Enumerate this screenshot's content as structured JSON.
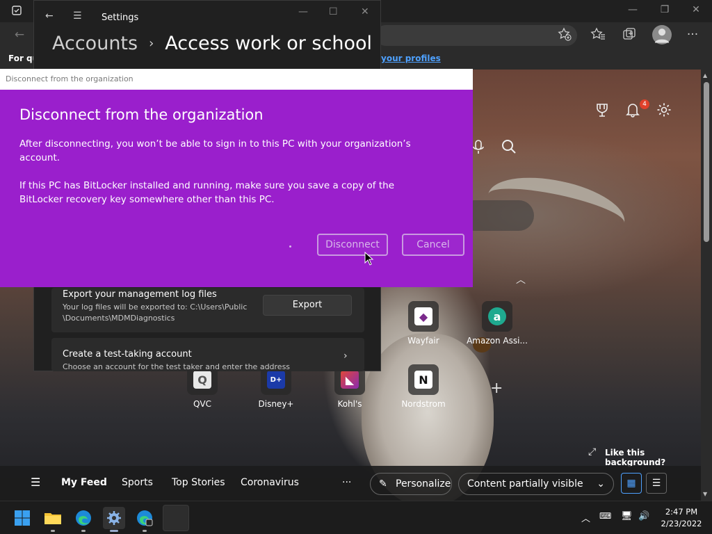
{
  "browser": {
    "favbar_label": "For qu",
    "favbar_link": "your profiles",
    "notifications_count": "4",
    "like_background": "Like this background?"
  },
  "tiles": [
    {
      "label": "Wayfair",
      "glyph": "◆",
      "color": "#7b2a8c"
    },
    {
      "label": "Amazon Assi...",
      "glyph": "a",
      "color": "#1fa98f"
    },
    {
      "label": "QVC",
      "glyph": "Q",
      "color": "#cfcfcf"
    },
    {
      "label": "Disney+",
      "glyph": "D+",
      "color": "#1b3aa8"
    },
    {
      "label": "Kohl's",
      "glyph": "◣",
      "color": "#b01c2c"
    },
    {
      "label": "Nordstrom",
      "glyph": "N",
      "color": "#ffffff"
    }
  ],
  "feed": {
    "items": [
      "My Feed",
      "Sports",
      "Top Stories",
      "Coronavirus"
    ],
    "more": "···",
    "personalize": "Personalize",
    "content_visibility": "Content partially visible"
  },
  "settings": {
    "title": "Settings",
    "breadcrumb_parent": "Accounts",
    "breadcrumb_current": "Access work or school",
    "export_card": {
      "title": "Export your management log files",
      "subtitle_line1": "Your log files will be exported to: C:\\Users\\Public",
      "subtitle_line2": "\\Documents\\MDMDiagnostics",
      "button": "Export"
    },
    "test_card": {
      "title": "Create a test-taking account",
      "subtitle": "Choose an account for the test taker and enter the address"
    }
  },
  "dialog": {
    "window_title": "Disconnect from the organization",
    "heading": "Disconnect from the organization",
    "paragraph1": "After disconnecting, you won’t be able to sign in to this PC with your organization’s account.",
    "paragraph2": "If this PC has BitLocker installed and running, make sure you save a copy of the BitLocker recovery key somewhere other than this PC.",
    "disconnect_button": "Disconnect",
    "cancel_button": "Cancel"
  },
  "taskbar": {
    "time": "2:47 PM",
    "date": "2/23/2022"
  },
  "colors": {
    "dialog_bg": "#9a1fcc",
    "link": "#4ea1ff",
    "badge": "#e0402a"
  }
}
